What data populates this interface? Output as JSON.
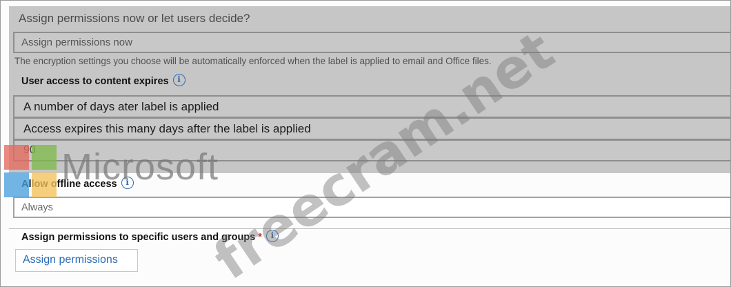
{
  "question": {
    "title": "Assign permissions now or let users decide?",
    "selected_option": "Assign permissions now"
  },
  "note": "The encryption settings you choose will be automatically enforced when the label is applied to email and Office files.",
  "expiry": {
    "label": "User access to content expires",
    "type_value": "A number of days ater label is applied",
    "description": "Access expires this many days after the label is applied",
    "days_value": "90"
  },
  "offline": {
    "label": "Allow offline access",
    "value": "Always"
  },
  "specific": {
    "label": "Assign permissions to specific users and groups",
    "required_mark": "*",
    "button_label": "Assign permissions"
  },
  "info_glyph": "i",
  "logo": {
    "word": "Microsoft",
    "colors": [
      "#e46a5e",
      "#7fb84a",
      "#4a9fdb",
      "#f4c25a"
    ]
  },
  "watermark": "freecram.net",
  "colors": {
    "accent": "#2a6cb6",
    "required": "#d22828",
    "disabled_panel": "#c6c6c6"
  }
}
